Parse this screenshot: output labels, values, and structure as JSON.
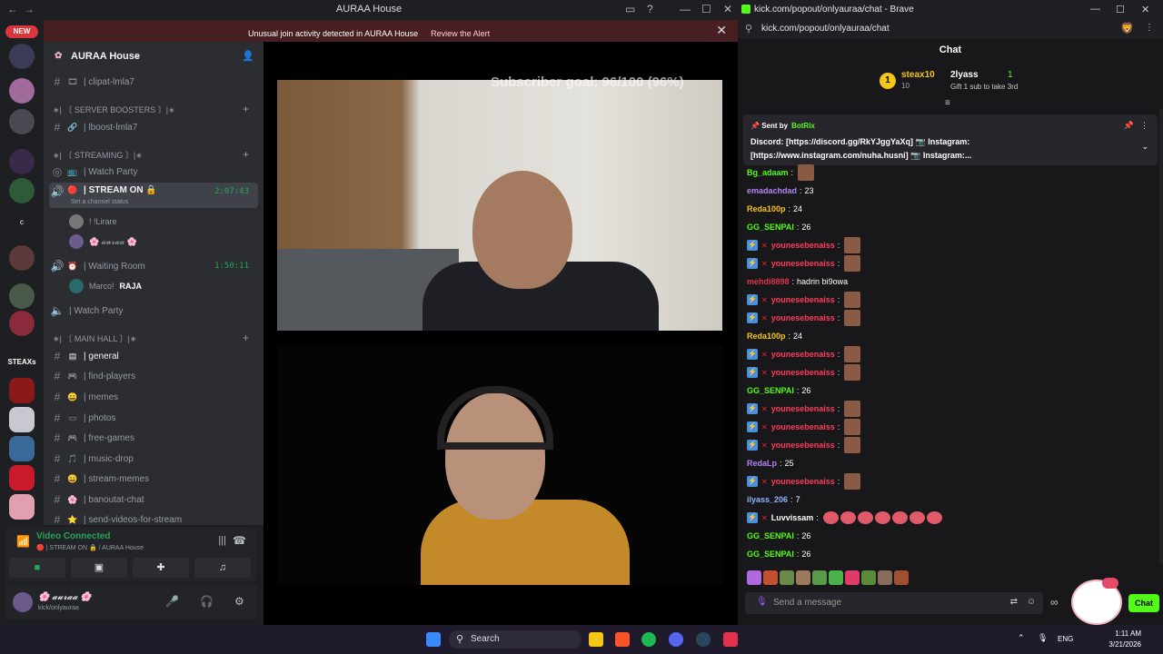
{
  "discord": {
    "window_title": "AURAA House",
    "new_badge": "NEW",
    "alert": {
      "message": "Unusual join activity detected in AURAA House",
      "action": "Review the Alert"
    },
    "server_name": "AURAA House",
    "rail_labels": {
      "steaxs": "STEAXs",
      "c": "c"
    },
    "channels": [
      {
        "type": "text",
        "label": "| clipat-lmla7"
      },
      {
        "type": "category",
        "label": "∗| 〔 SERVER BOOSTERS 〕|∗"
      },
      {
        "type": "text",
        "label": "| lboost-lmla7"
      },
      {
        "type": "category",
        "label": "∗| 〔 STREAMING 〕|∗"
      },
      {
        "type": "voice",
        "label": "| Watch Party"
      },
      {
        "type": "voice-active",
        "label": "| STREAM ON 🔒",
        "time": "2:07:43",
        "status": "Set a channel status"
      },
      {
        "type": "voice",
        "label": "| Waiting Room",
        "time": "1:50:11"
      },
      {
        "type": "voice",
        "label": "| Watch Party"
      },
      {
        "type": "category",
        "label": "∗| 〔 MAIN HALL 〕|∗"
      },
      {
        "type": "text",
        "label": "| general"
      },
      {
        "type": "text",
        "label": "| find-players"
      },
      {
        "type": "text",
        "label": "| memes"
      },
      {
        "type": "text",
        "label": "| photos"
      },
      {
        "type": "text",
        "label": "| free-games"
      },
      {
        "type": "text",
        "label": "| music-drop"
      },
      {
        "type": "text",
        "label": "| stream-memes"
      },
      {
        "type": "text",
        "label": "| banoutat-chat"
      },
      {
        "type": "text",
        "label": "| send-videos-for-stream"
      }
    ],
    "voice_users": [
      {
        "name": "! !Lirare"
      },
      {
        "name": "🌸 𝓪𝓾𝓻𝓪𝓪 🌸"
      },
      {
        "name": "Marco!",
        "tag": "RAJA"
      }
    ],
    "voice_connected": {
      "title": "Video Connected",
      "subtitle": "🔴 | STREAM ON 🔒 / AURAA House"
    },
    "user": {
      "name": "🌸 𝓪𝓾𝓻𝓪𝓪 🌸",
      "status": "kick/onlyauraa"
    },
    "subscriber_goal": "Subscriber goal: 96/100 (96%)"
  },
  "browser": {
    "title": "kick.com/popout/onlyauraa/chat - Brave",
    "url": "kick.com/popout/onlyauraa/chat",
    "chat_header": "Chat",
    "top_gifter": {
      "rank": "1",
      "name": "steax10",
      "count": "10",
      "second": "2lyass",
      "second_count": "1",
      "gift_text": "Gift 1 sub to take 3rd"
    },
    "pinned": {
      "sent_by": "Sent by",
      "bot": "BotRix",
      "line1": "Discord: [https://discord.gg/RkYJggYaXq] 📷 Instagram:",
      "line2": "[https://www.instagram.com/nuha.husni] 📷 Instagram:..."
    },
    "messages": [
      {
        "user": "Bg_adaam",
        "text": "",
        "color": "#53fc18",
        "emotes": 1
      },
      {
        "user": "emadachdad",
        "text": "23",
        "color": "#b084f5"
      },
      {
        "user": "Reda100p",
        "text": "24",
        "color": "#f5c518"
      },
      {
        "user": "GG_SENPAI",
        "text": "26",
        "color": "#53fc18"
      },
      {
        "user": "younesebenaiss",
        "text": "",
        "color": "#ff3b5c",
        "emotes": 1
      },
      {
        "user": "younesebenaiss",
        "text": "",
        "color": "#ff3b5c",
        "emotes": 1
      },
      {
        "user": "mehdi8898",
        "text": "hadrin bi9owa",
        "color": "#e0334a"
      },
      {
        "user": "younesebenaiss",
        "text": "",
        "color": "#ff3b5c",
        "emotes": 1
      },
      {
        "user": "younesebenaiss",
        "text": "",
        "color": "#ff3b5c",
        "emotes": 1
      },
      {
        "user": "Reda100p",
        "text": "24",
        "color": "#f5c518"
      },
      {
        "user": "younesebenaiss",
        "text": "",
        "color": "#ff3b5c",
        "emotes": 1
      },
      {
        "user": "younesebenaiss",
        "text": "",
        "color": "#ff3b5c",
        "emotes": 1
      },
      {
        "user": "GG_SENPAI",
        "text": "26",
        "color": "#53fc18"
      },
      {
        "user": "younesebenaiss",
        "text": "",
        "color": "#ff3b5c",
        "emotes": 1
      },
      {
        "user": "younesebenaiss",
        "text": "",
        "color": "#ff3b5c",
        "emotes": 1
      },
      {
        "user": "younesebenaiss",
        "text": "",
        "color": "#ff3b5c",
        "emotes": 1
      },
      {
        "user": "RedaLp",
        "text": "25",
        "color": "#b084f5"
      },
      {
        "user": "younesebenaiss",
        "text": "",
        "color": "#ff3b5c",
        "emotes": 1
      },
      {
        "user": "ilyass_206",
        "text": "7",
        "color": "#8ab4f8"
      },
      {
        "user": "Luvvissam",
        "text": "",
        "color": "#fff",
        "emotes": 7
      },
      {
        "user": "GG_SENPAI",
        "text": "26",
        "color": "#53fc18"
      },
      {
        "user": "GG_SENPAI",
        "text": "26",
        "color": "#53fc18"
      }
    ],
    "input_placeholder": "Send a message",
    "chat_button": "Chat"
  },
  "taskbar": {
    "search": "Search",
    "lang": "ENG",
    "time": "1:11 AM",
    "date": "3/21/2026"
  }
}
